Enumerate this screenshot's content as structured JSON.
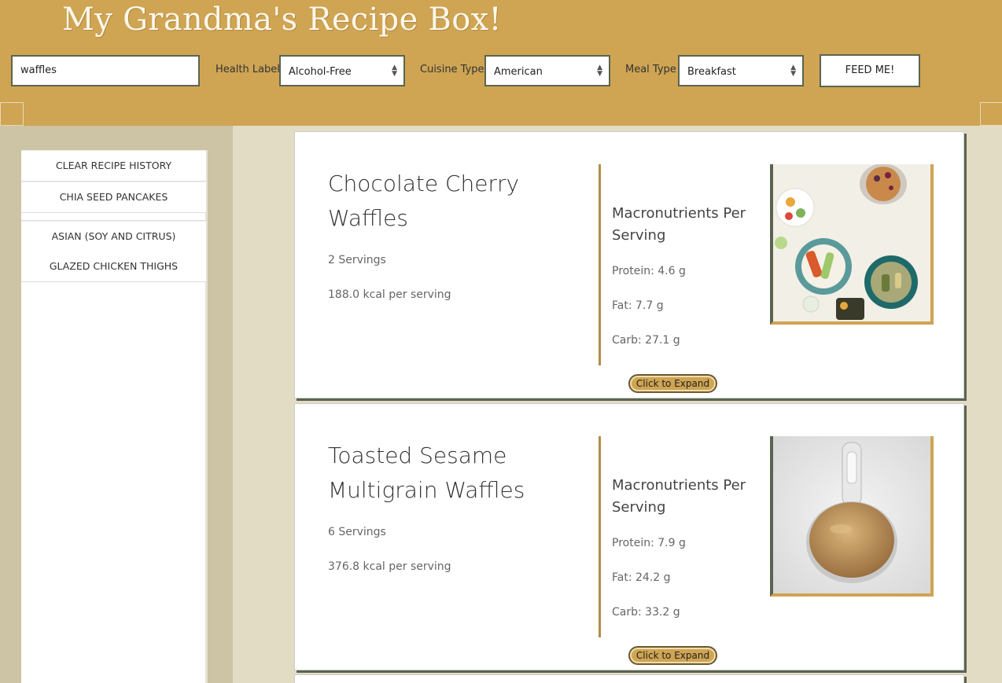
{
  "header": {
    "title": "My Grandma's Recipe Box!",
    "search_value": "waffles",
    "filters": [
      {
        "label": "Health Label",
        "value": "Alcohol-Free"
      },
      {
        "label": "Cuisine Type",
        "value": "American"
      },
      {
        "label": "Meal Type",
        "value": "Breakfast"
      }
    ],
    "submit_label": "FEED ME!"
  },
  "sidebar": {
    "items": [
      {
        "label": "CLEAR RECIPE HISTORY"
      },
      {
        "label": "CHIA SEED PANCAKES"
      },
      {
        "label_line1": "ASIAN (SOY AND CITRUS)",
        "label_line2": "GLAZED CHICKEN THIGHS"
      }
    ]
  },
  "recipes": [
    {
      "title_line1": "Chocolate Cherry",
      "title_line2": "Waffles",
      "servings": "2 Servings",
      "kcal": "188.0 kcal per serving",
      "macro_title_line1": "Macronutrients Per",
      "macro_title_line2": "Serving",
      "protein": "Protein: 4.6 g",
      "fat": "Fat: 7.7 g",
      "carb": "Carb: 27.1 g",
      "expand_label": "Click to Expand",
      "image": "food-bowls-image"
    },
    {
      "title_line1": "Toasted Sesame",
      "title_line2": "Multigrain Waffles",
      "servings": "6 Servings",
      "kcal": "376.8 kcal per serving",
      "macro_title_line1": "Macronutrients Per",
      "macro_title_line2": "Serving",
      "protein": "Protein: 7.9 g",
      "fat": "Fat: 24.2 g",
      "carb": "Carb: 33.2 g",
      "expand_label": "Click to Expand",
      "image": "sesame-seeds-scoop-image"
    }
  ],
  "colors": {
    "header_bg": "#cfa453",
    "accent_dark": "#5a6450",
    "page_bg": "#e3dcc5",
    "sidebar_bg": "#cdc3a5"
  }
}
